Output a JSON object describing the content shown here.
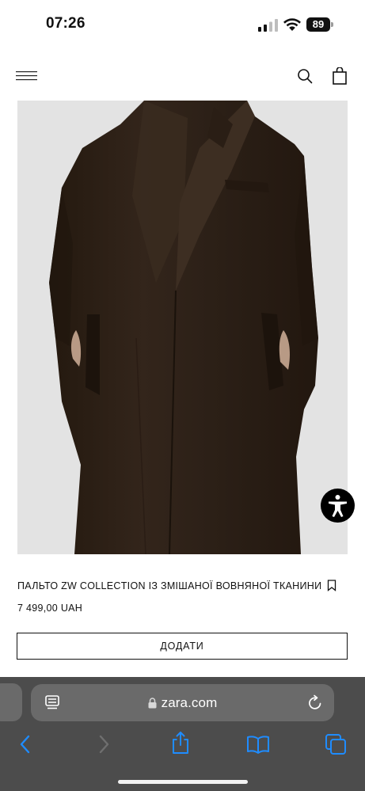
{
  "status_bar": {
    "time": "07:26",
    "battery_level": "89"
  },
  "header": {
    "menu_icon": "hamburger-menu-icon",
    "search_icon": "search-icon",
    "bag_icon": "shopping-bag-icon"
  },
  "product": {
    "name": "ПАЛЬТО ZW COLLECTION ІЗ ЗМІШАНОЇ ВОВНЯНОЇ ТКАНИНИ",
    "price": "7 499,00 UAH",
    "add_button_label": "ДОДАТИ",
    "image_colors": {
      "background": "#e3e3e3",
      "coat": "#2e2118"
    }
  },
  "browser": {
    "url": "zara.com",
    "toolbar_icons": [
      "back-icon",
      "forward-icon",
      "share-icon",
      "bookmarks-icon",
      "tabs-icon"
    ],
    "accent_color": "#1f8cff"
  }
}
